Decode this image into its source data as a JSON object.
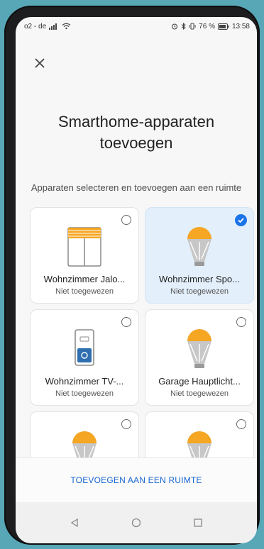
{
  "status": {
    "carrier": "o2 - de",
    "battery_percent": "76 %",
    "time": "13:58"
  },
  "header": {
    "title": "Smarthome-apparaten toevoegen",
    "subtitle": "Apparaten selecteren en toevoegen aan een ruimte"
  },
  "devices": [
    {
      "name": "Wohnzimmer Jalo...",
      "status": "Niet toegewezen",
      "selected": false,
      "icon": "blinds-icon"
    },
    {
      "name": "Wohnzimmer Spo...",
      "status": "Niet toegewezen",
      "selected": true,
      "icon": "bulb-icon"
    },
    {
      "name": "Wohnzimmer TV-...",
      "status": "Niet toegewezen",
      "selected": false,
      "icon": "switch-icon"
    },
    {
      "name": "Garage Hauptlicht...",
      "status": "Niet toegewezen",
      "selected": false,
      "icon": "bulb-icon"
    },
    {
      "name": "",
      "status": "",
      "selected": false,
      "icon": "bulb-icon"
    },
    {
      "name": "",
      "status": "",
      "selected": false,
      "icon": "bulb-icon"
    }
  ],
  "footer": {
    "action_label": "TOEVOEGEN AAN EEN RUIMTE"
  },
  "colors": {
    "accent": "#1a73e8",
    "selected_card": "#e3effa",
    "bulb": "#f5a623"
  }
}
